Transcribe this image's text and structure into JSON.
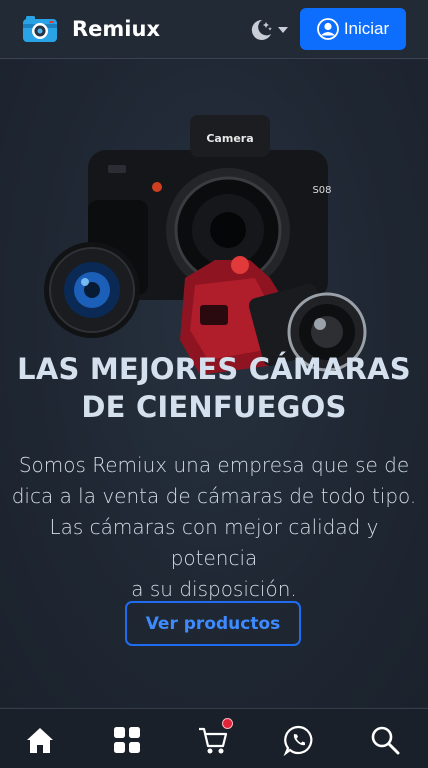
{
  "header": {
    "brand_name": "Remiux",
    "brand_icon": "camera-icon",
    "theme_icon": "moon-stars-icon",
    "login_label": "Iniciar",
    "login_icon": "user-circle-icon"
  },
  "hero": {
    "title_lines": [
      "LAS MEJORES CÁMARAS",
      "DE CIENFUEGOS"
    ],
    "text_lines": [
      "Somos Remiux una empresa que se de",
      "dica a la venta de cámaras de todo tipo.",
      "Las cámaras con mejor calidad y potencia",
      "a su disposición."
    ],
    "cta_label": "Ver productos",
    "image_texts": {
      "camera_label": "Camera",
      "model_badge": "S08"
    }
  },
  "bottom_nav": {
    "items": [
      {
        "icon": "home-icon"
      },
      {
        "icon": "grid-icon"
      },
      {
        "icon": "cart-icon"
      },
      {
        "icon": "whatsapp-icon"
      },
      {
        "icon": "search-icon"
      }
    ],
    "cart_badge_color": "#e0243a"
  },
  "colors": {
    "accent": "#0d6efd",
    "background": "#1f2632"
  }
}
